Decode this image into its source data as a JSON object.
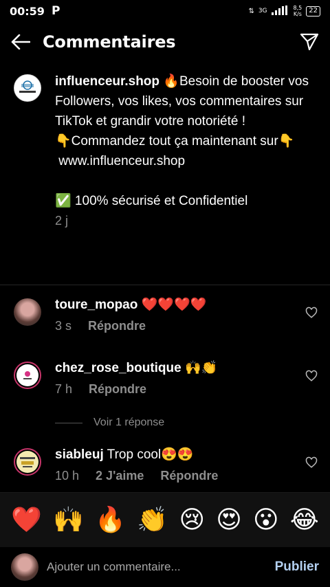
{
  "status": {
    "time": "00:59",
    "app_glyph": "P",
    "net": "3G",
    "speed_value": "8,5",
    "speed_unit": "K/s",
    "battery": "22"
  },
  "header": {
    "title": "Commentaires",
    "back_icon": "back-arrow-icon",
    "send_icon": "send-icon"
  },
  "caption": {
    "username": "influenceur.shop",
    "text": " 🔥Besoin de booster vos Followers, vos likes, vos commentaires sur TikTok et grandir votre notoriété !\n👇Commandez tout ça maintenant sur👇\n www.influenceur.shop\n\n✅ 100% sécurisé et Confidentiel",
    "time": "2 j",
    "avatar_text": "influenceur"
  },
  "comments": [
    {
      "username": "toure_mopao",
      "text": " ❤️❤️❤️❤️",
      "time": "3 s",
      "likes": "",
      "reply": "Répondre"
    },
    {
      "username": "chez_rose_boutique",
      "text": " 🙌👏",
      "time": "7 h",
      "likes": "",
      "reply": "Répondre"
    },
    {
      "username": "siableuj",
      "text": " Trop cool😍😍",
      "time": "10 h",
      "likes": "2 J'aime",
      "reply": "Répondre"
    }
  ],
  "replies_toggle": "Voir 1 réponse",
  "emoji_bar": [
    "❤️",
    "🙌",
    "🔥",
    "👏",
    "😢",
    "😍",
    "😮",
    "😂"
  ],
  "composer": {
    "placeholder": "Ajouter un commentaire...",
    "publish_label": "Publier"
  },
  "colors": {
    "background": "#000000",
    "secondary_text": "#8e8e8e",
    "publish": "#b3d0f1"
  }
}
